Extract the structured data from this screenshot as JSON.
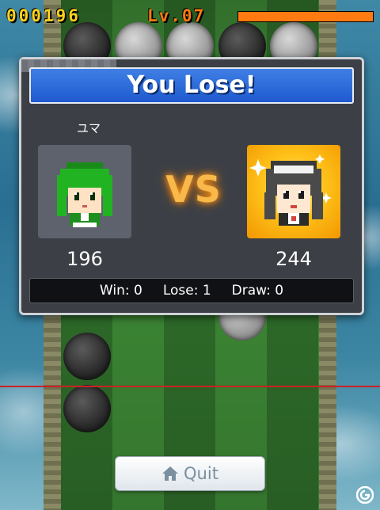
{
  "hud": {
    "score": "000196",
    "level": "Lv.07",
    "level_bar_fraction": 1.0
  },
  "result": {
    "title": "You Lose!",
    "player_name": "ユマ",
    "vs_label": "VS",
    "player_points": "196",
    "opponent_points": "244",
    "record": {
      "win": "Win: 0",
      "lose": "Lose: 1",
      "draw": "Draw: 0"
    }
  },
  "quit_label": "Quit",
  "icons": {
    "quit": "home-icon",
    "watermark": "site-logo-icon"
  },
  "colors": {
    "score": "#ffd21a",
    "level": "#ff7a10",
    "banner": "#2a66dc",
    "vs": "#f8b84a"
  }
}
